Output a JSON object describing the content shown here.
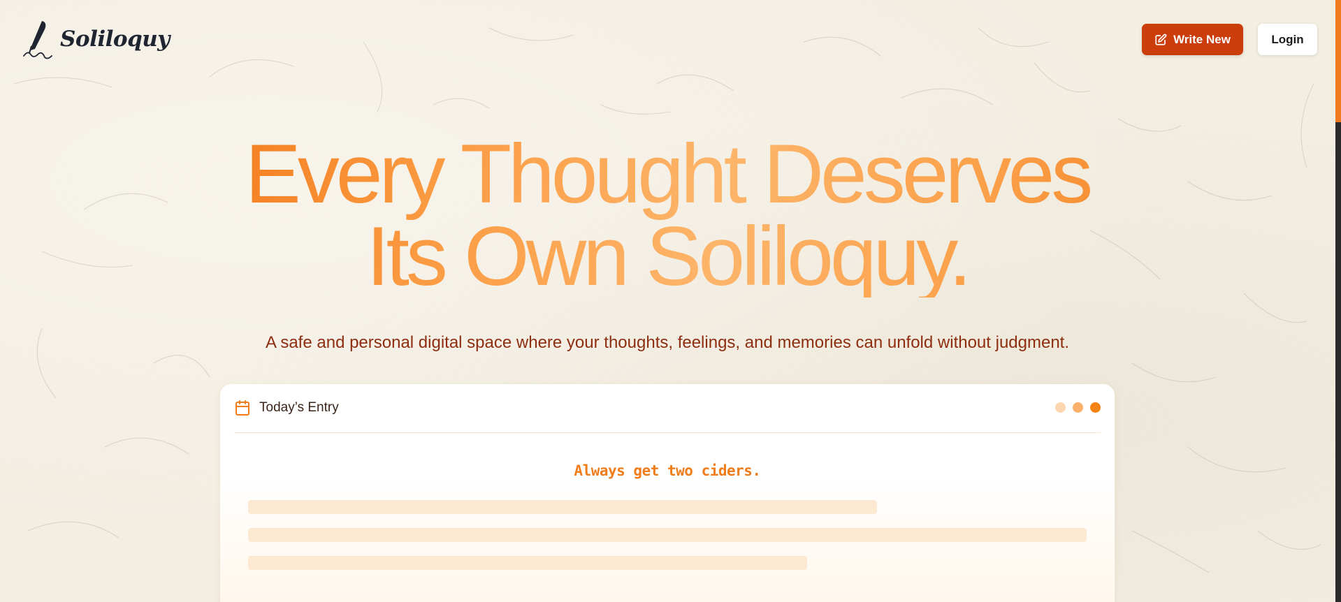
{
  "header": {
    "brand": "Soliloquy",
    "write_label": "Write New",
    "login_label": "Login"
  },
  "hero": {
    "title_line1": "Every Thought Deserves",
    "title_line2": "Its Own Soliloquy.",
    "subtitle": "A safe and personal digital space where your thoughts, feelings, and memories can unfold without judgment."
  },
  "entry_card": {
    "label": "Today’s Entry",
    "title": "Always get two ciders."
  },
  "colors": {
    "accent": "#f07c1a",
    "primary_button": "#cc3d0c",
    "subtitle_text": "#8e2e10",
    "dot_light": "#fdd6b0",
    "dot_mid": "#fbb06b",
    "dot_strong": "#f58214"
  },
  "icons": {
    "brand": "quill-pen-icon",
    "write": "edit-square-icon",
    "entry": "calendar-icon"
  }
}
